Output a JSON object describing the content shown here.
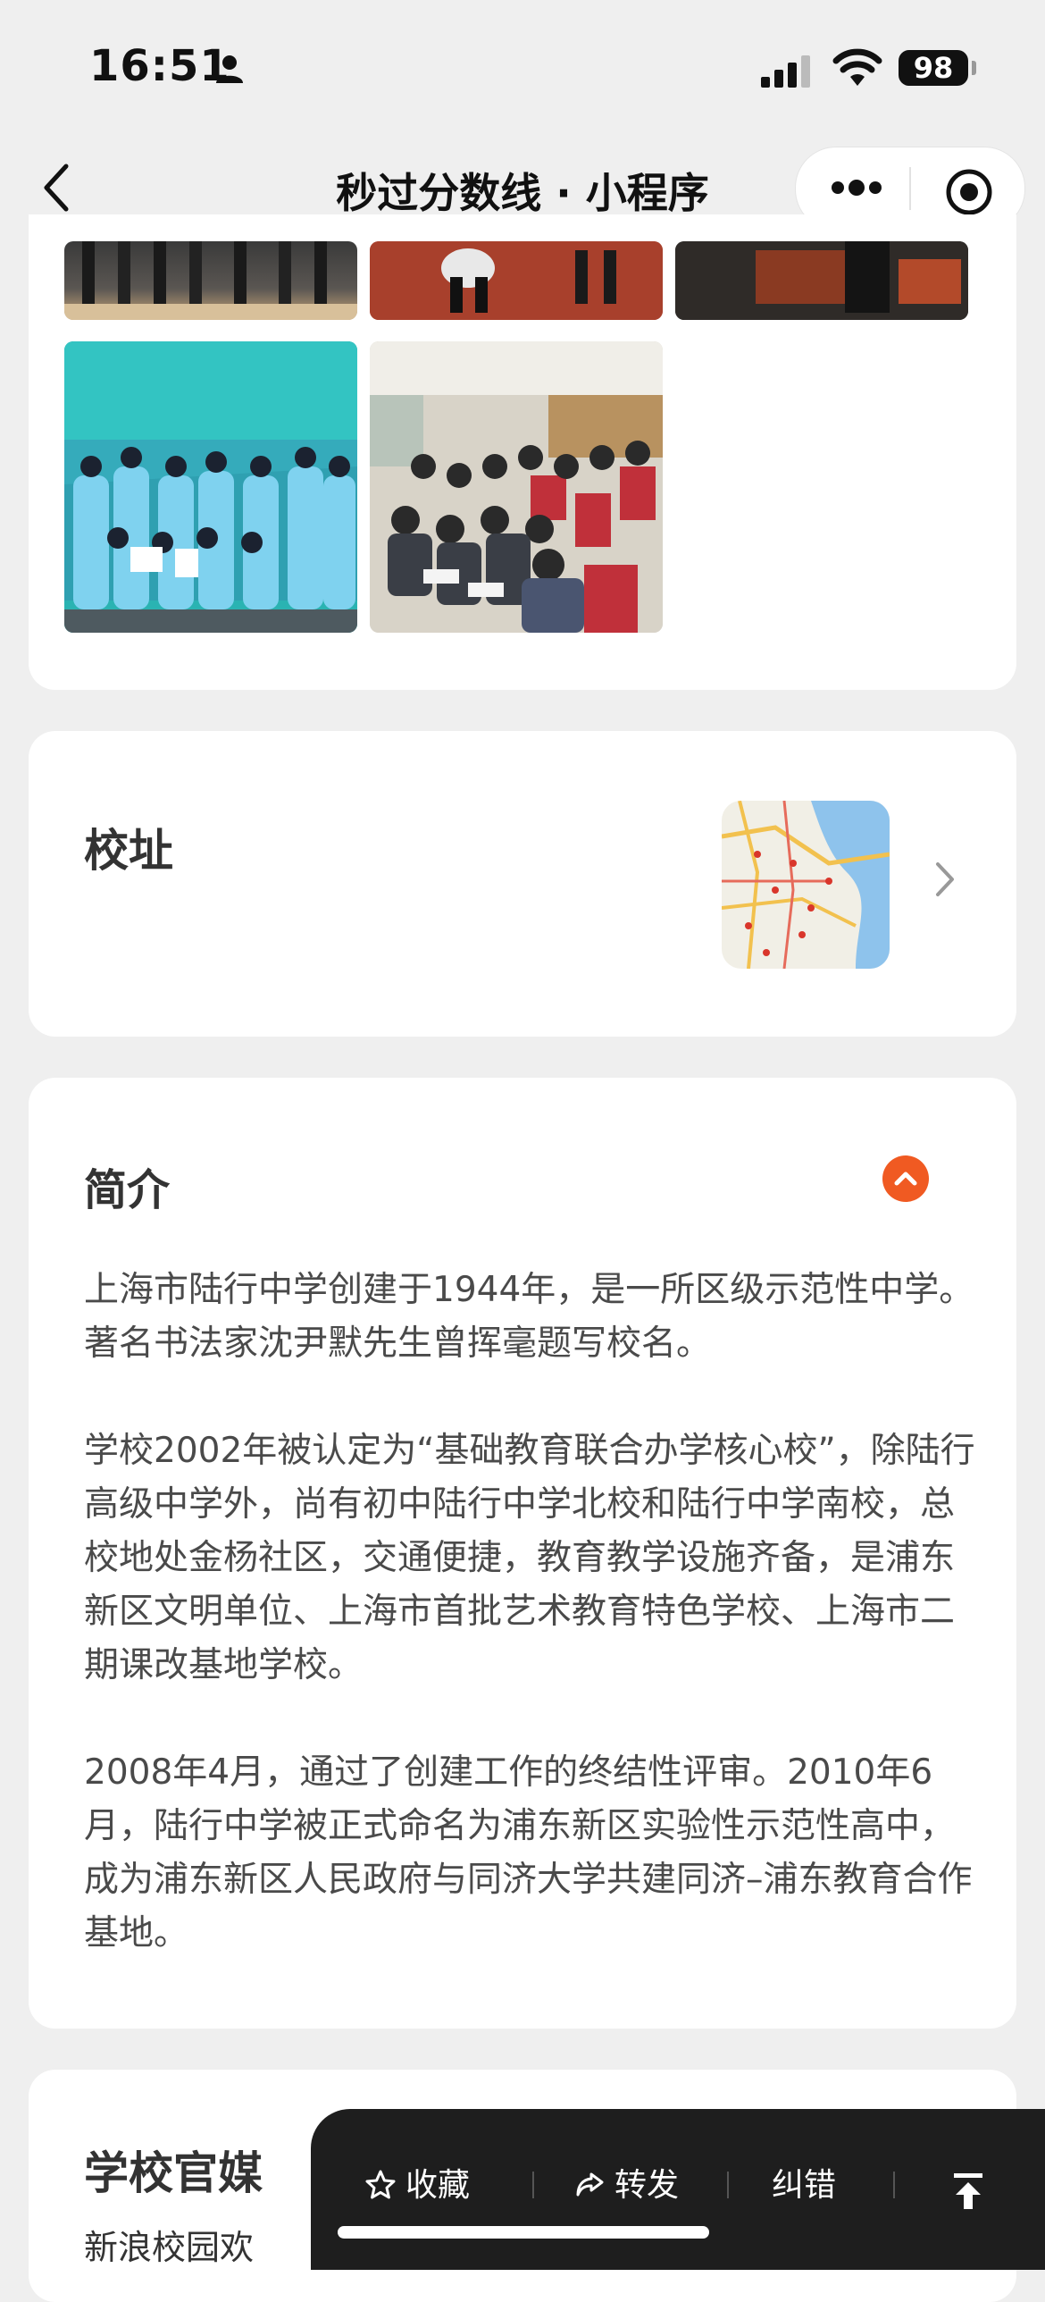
{
  "status_bar": {
    "time": "16:51",
    "battery": "98"
  },
  "nav": {
    "title": "秒过分数线 · 小程序"
  },
  "address": {
    "title": "校址"
  },
  "intro": {
    "title": "简介",
    "paragraphs": [
      "上海市陆行中学创建于1944年，是一所区级示范性中学。著名书法家沈尹默先生曾挥毫题写校名。",
      "学校2002年被认定为“基础教育联合办学核心校”，除陆行高级中学外，尚有初中陆行中学北校和陆行中学南校，总校地处金杨社区，交通便捷，教育教学设施齐备，是浦东新区文明单位、上海市首批艺术教育特色学校、上海市二期课改基地学校。",
      "2008年4月，通过了创建工作的终结性评审。2010年6月，陆行中学被正式命名为浦东新区实验性示范性高中，成为浦东新区人民政府与同济大学共建同济–浦东教育合作基地。"
    ]
  },
  "media": {
    "title": "学校官媒",
    "first_item": "新浪校园欢"
  },
  "bottom_bar": {
    "favorite": "收藏",
    "share": "转发",
    "correct": "纠错"
  },
  "colors": {
    "accent": "#f05a22",
    "background": "#efefef",
    "bar": "#1e1e1e"
  },
  "icons": [
    "person-icon",
    "signal-icon",
    "wifi-icon",
    "back-icon",
    "more-icon",
    "mini-close-icon",
    "chevron-right-icon",
    "chevron-up-icon",
    "star-icon",
    "share-icon",
    "back-to-top-icon"
  ]
}
